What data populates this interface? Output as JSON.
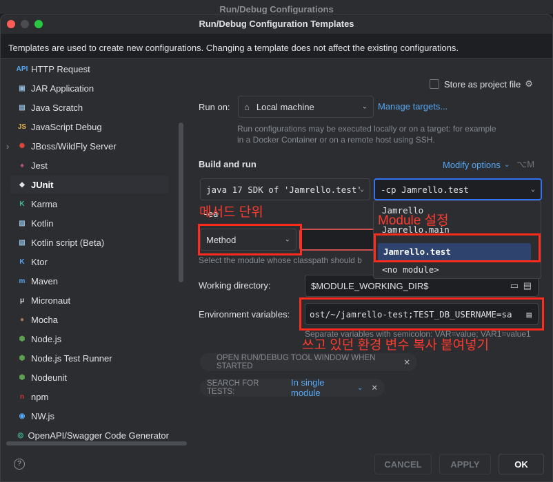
{
  "background_window": {
    "title": "Run/Debug Configurations"
  },
  "window": {
    "title": "Run/Debug Configuration Templates"
  },
  "banner": "Templates are used to create new configurations. Changing a template does not affect the existing configurations.",
  "sidebar": {
    "items": [
      {
        "label": "HTTP Request",
        "icon": "api-icon",
        "glyph": "API",
        "color": "#56a8f5"
      },
      {
        "label": "JAR Application",
        "icon": "jar-icon",
        "glyph": "▣",
        "color": "#8fb7d8"
      },
      {
        "label": "Java Scratch",
        "icon": "java-scratch-icon",
        "glyph": "▤",
        "color": "#8fb7d8"
      },
      {
        "label": "JavaScript Debug",
        "icon": "js-debug-icon",
        "glyph": "JS",
        "color": "#e8b14b"
      },
      {
        "label": "JBoss/WildFly Server",
        "icon": "jboss-icon",
        "glyph": "✺",
        "color": "#e0463a"
      },
      {
        "label": "Jest",
        "icon": "jest-icon",
        "glyph": "♠",
        "color": "#c2566a"
      },
      {
        "label": "JUnit",
        "icon": "junit-icon",
        "glyph": "◆",
        "color": "#dfe1e5"
      },
      {
        "label": "Karma",
        "icon": "karma-icon",
        "glyph": "K",
        "color": "#3fbf8e"
      },
      {
        "label": "Kotlin",
        "icon": "kotlin-icon",
        "glyph": "▨",
        "color": "#8fb7d8"
      },
      {
        "label": "Kotlin script (Beta)",
        "icon": "kotlin-script-icon",
        "glyph": "▧",
        "color": "#8fb7d8"
      },
      {
        "label": "Ktor",
        "icon": "ktor-icon",
        "glyph": "K",
        "color": "#56a8f5"
      },
      {
        "label": "Maven",
        "icon": "maven-icon",
        "glyph": "m",
        "color": "#56a8f5"
      },
      {
        "label": "Micronaut",
        "icon": "micronaut-icon",
        "glyph": "μ",
        "color": "#dfe1e5"
      },
      {
        "label": "Mocha",
        "icon": "mocha-icon",
        "glyph": "●",
        "color": "#a57a5a"
      },
      {
        "label": "Node.js",
        "icon": "nodejs-icon",
        "glyph": "⬢",
        "color": "#5fa04e"
      },
      {
        "label": "Node.js Test Runner",
        "icon": "nodejs-test-icon",
        "glyph": "⬢",
        "color": "#5fa04e"
      },
      {
        "label": "Nodeunit",
        "icon": "nodeunit-icon",
        "glyph": "⬢",
        "color": "#5fa04e"
      },
      {
        "label": "npm",
        "icon": "npm-icon",
        "glyph": "n",
        "color": "#cb3837"
      },
      {
        "label": "NW.js",
        "icon": "nwjs-icon",
        "glyph": "◉",
        "color": "#56a8f5"
      },
      {
        "label": "OpenAPI/Swagger Code Generator",
        "icon": "openapi-icon",
        "glyph": "◎",
        "color": "#3fbf8e"
      }
    ]
  },
  "form": {
    "store_label": "Store as project file",
    "run_on_label": "Run on:",
    "run_on_value": "Local machine",
    "manage_targets": "Manage targets...",
    "run_hint": "Run configurations may be executed locally or on a target: for example in a Docker Container or on a remote host using SSH.",
    "build_and_run": "Build and run",
    "modify_options": "Modify options",
    "modify_shortcut": "⌥M",
    "sdk_value": "java 17  SDK of 'Jamrello.test'",
    "cp_value": "-cp Jamrello.test",
    "vm_partial": "-ea",
    "method_value": "Method",
    "module_hint": "Select the module whose classpath should b",
    "working_dir_label": "Working directory:",
    "working_dir_value": "$MODULE_WORKING_DIR$",
    "env_label": "Environment variables:",
    "env_value": "ost/~/jamrello-test;TEST_DB_USERNAME=sa",
    "env_hint": "Separate variables with semicolon: VAR=value; VAR1=value1",
    "chip_open": "OPEN RUN/DEBUG TOOL WINDOW WHEN STARTED",
    "chip_search_label": "SEARCH FOR TESTS:",
    "chip_search_value": "In single module"
  },
  "popup": {
    "items": [
      "Jamrello",
      "Jamrello.main",
      "Jamrello.test",
      "<no module>"
    ],
    "selected": "Jamrello.test"
  },
  "annotations": {
    "method": "메서드 단위",
    "module": "Module 설정",
    "env": "쓰고 있던 환경 변수 복사 붙여넣기"
  },
  "buttons": {
    "cancel": "CANCEL",
    "apply": "APPLY",
    "ok": "OK",
    "help": "?"
  },
  "colors": {
    "accent": "#56a8f5",
    "annotation": "#ff2b1c"
  }
}
